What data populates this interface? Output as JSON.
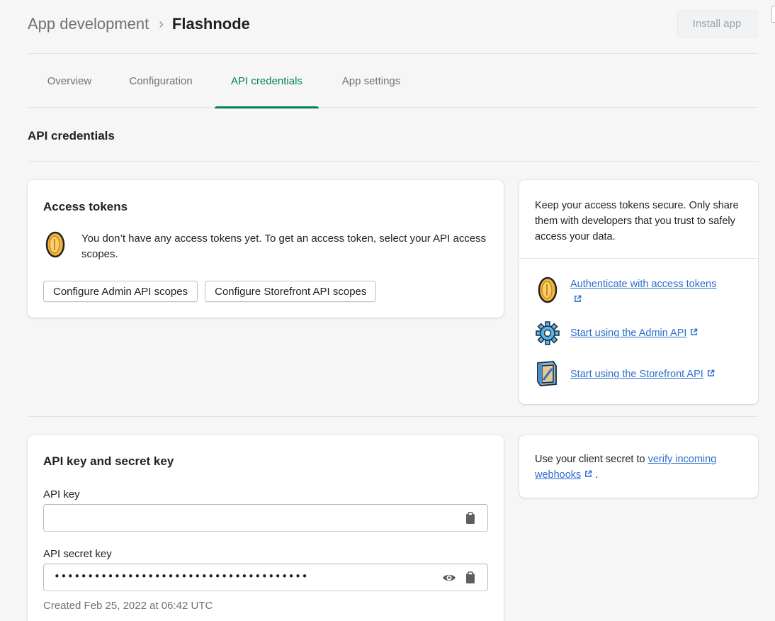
{
  "header": {
    "breadcrumb_parent": "App development",
    "breadcrumb_separator": "›",
    "breadcrumb_current": "Flashnode",
    "install_button": "Install app"
  },
  "tabs": [
    {
      "label": "Overview",
      "active": false
    },
    {
      "label": "Configuration",
      "active": false
    },
    {
      "label": "API credentials",
      "active": true
    },
    {
      "label": "App settings",
      "active": false
    }
  ],
  "section_title": "API credentials",
  "access_tokens": {
    "title": "Access tokens",
    "notice": "You don’t have any access tokens yet. To get an access token, select your API access scopes.",
    "buttons": [
      "Configure Admin API scopes",
      "Configure Storefront API scopes"
    ]
  },
  "side_card": {
    "text": "Keep your access tokens secure. Only share them with developers that you trust to safely access your data.",
    "resources": [
      {
        "label": "Authenticate with access tokens",
        "icon": "coin-icon"
      },
      {
        "label": "Start using the Admin API",
        "icon": "gear-icon"
      },
      {
        "label": "Start using the Storefront API",
        "icon": "storefront-icon"
      }
    ]
  },
  "keys": {
    "title": "API key and secret key",
    "api_key_label": "API key",
    "api_key_value": "",
    "secret_label": "API secret key",
    "secret_value": "••••••••••••••••••••••••••••••••••••••",
    "created": "Created Feb 25, 2022 at 06:42 UTC"
  },
  "webhook_card": {
    "text_before": "Use your client secret to ",
    "link": "verify incoming webhooks",
    "text_after": "."
  },
  "colors": {
    "accent": "#008060",
    "link": "#2c6ecb",
    "background": "#f6f6f7"
  }
}
